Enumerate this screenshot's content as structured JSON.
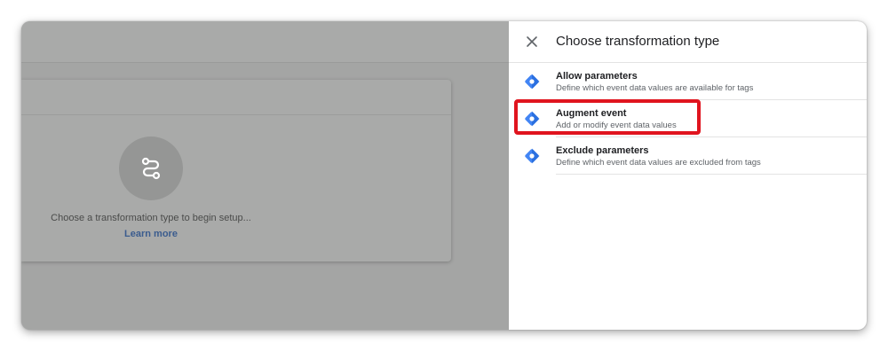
{
  "background": {
    "empty_state_message": "Choose a transformation type to begin setup...",
    "learn_more_label": "Learn more",
    "empty_state_icon": "route-icon"
  },
  "panel": {
    "title": "Choose transformation type",
    "close_icon": "close-icon",
    "options": [
      {
        "title": "Allow parameters",
        "description": "Define which event data values are available for tags",
        "icon": "tag-manager-diamond-icon"
      },
      {
        "title": "Augment event",
        "description": "Add or modify event data values",
        "icon": "tag-manager-diamond-icon",
        "highlighted": true
      },
      {
        "title": "Exclude parameters",
        "description": "Define which event data values are excluded from tags",
        "icon": "tag-manager-diamond-icon"
      }
    ]
  },
  "colors": {
    "highlight": "#e0141e",
    "icon_blue": "#4285f4",
    "icon_blue_dark": "#1a5fcf"
  }
}
